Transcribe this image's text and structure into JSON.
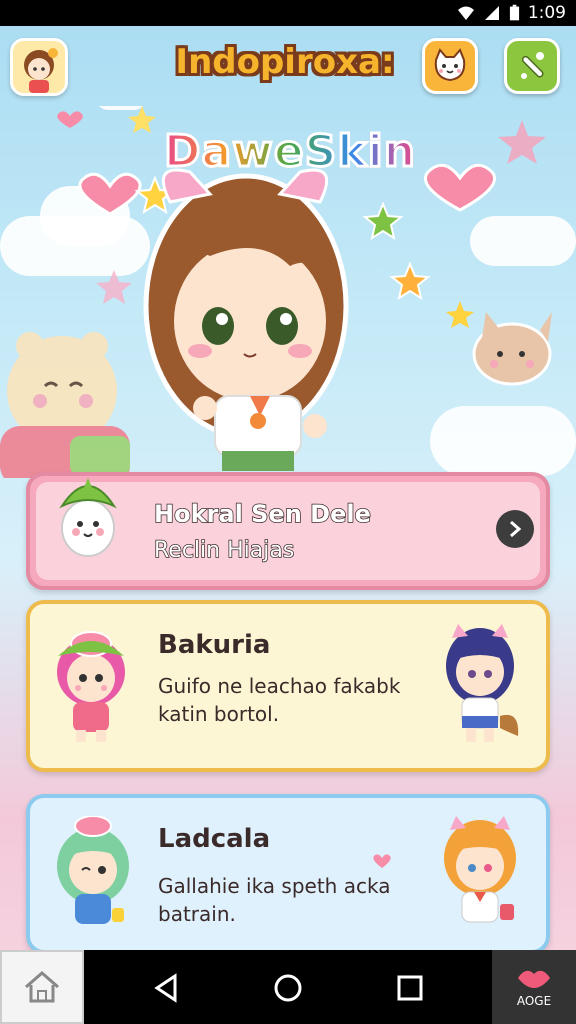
{
  "status_bar": {
    "time": "1:09"
  },
  "header": {
    "title": "Indopiroxa:",
    "avatar_icon": "girl-avatar-icon",
    "cat_button_icon": "cat-face-icon",
    "tool_button_icon": "wand-icon"
  },
  "hero": {
    "banner_text": "DaweSkin"
  },
  "cards": [
    {
      "title": "Hokral Sen Dele",
      "subtitle": "Reclin Hiajas",
      "action_icon": "chevron-right-icon"
    },
    {
      "title": "Bakuria",
      "subtitle": "Guifo ne leachao fakabk katin bortol."
    },
    {
      "title": "Ladcala",
      "subtitle": "Gallahie ika speth acka batrain."
    }
  ],
  "nav": {
    "extra_label": "AOGE",
    "home_icon": "home-icon",
    "back_icon": "back-triangle-icon",
    "circle_icon": "home-circle-icon",
    "recents_icon": "recents-square-icon"
  },
  "colors": {
    "title_fill": "#f6b32c",
    "title_outline": "#7a3b1c",
    "card1_border": "#e48aa3",
    "card2_border": "#eebc4c",
    "card3_border": "#8ccbee"
  }
}
